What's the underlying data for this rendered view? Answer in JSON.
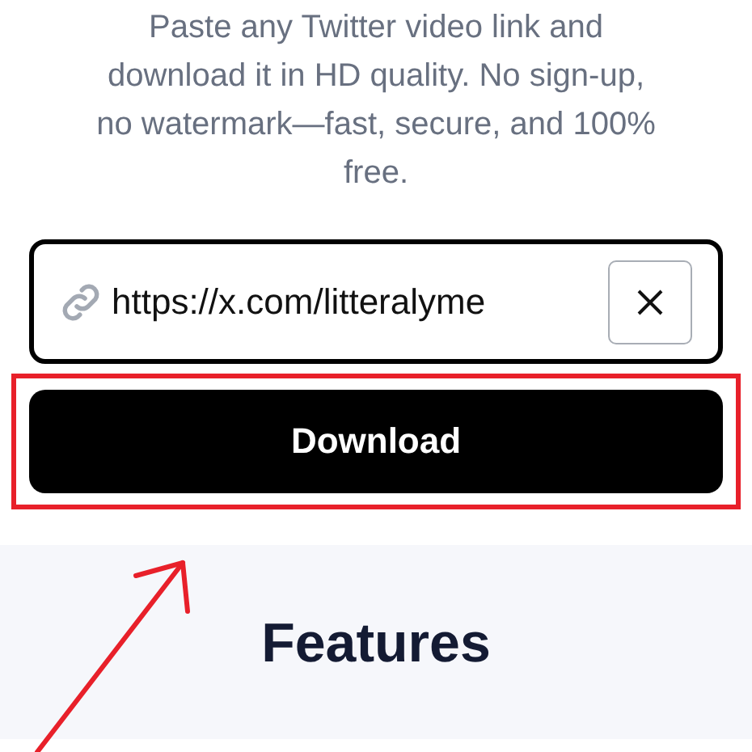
{
  "description": "Paste any Twitter video link and download it in HD quality. No sign-up, no watermark—fast, secure, and 100% free.",
  "url_input": {
    "value": "https://x.com/litteralyme"
  },
  "download_button": {
    "label": "Download"
  },
  "features": {
    "heading": "Features"
  }
}
